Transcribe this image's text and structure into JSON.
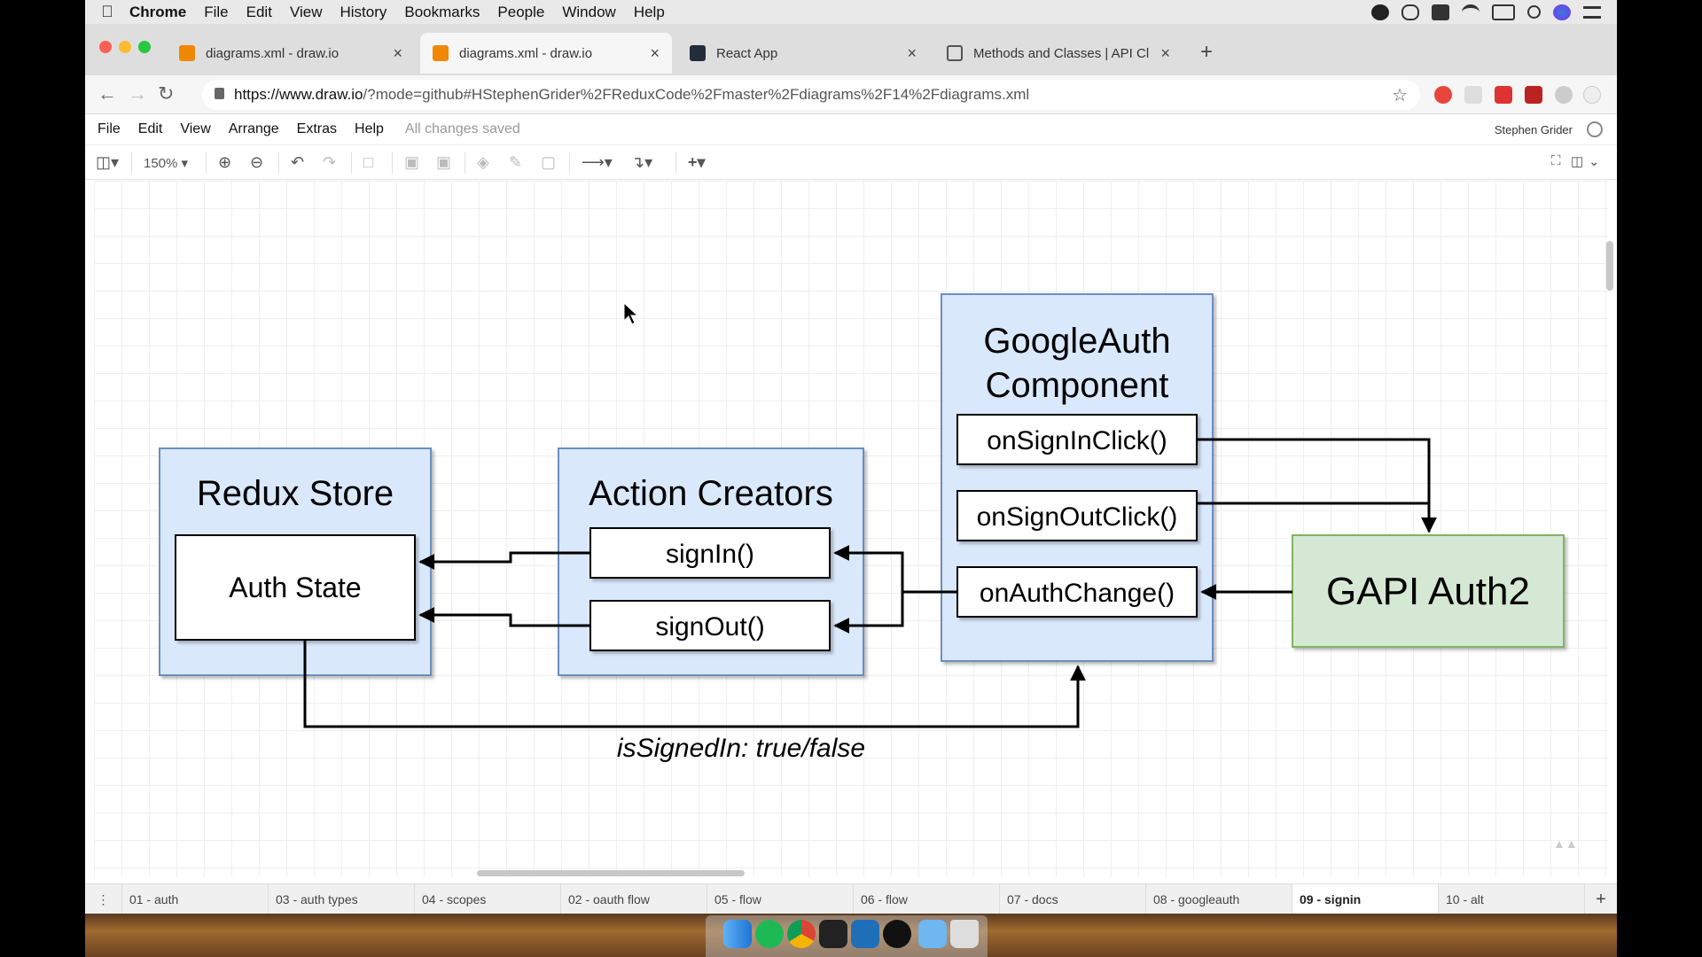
{
  "menubar": {
    "app_name": "Chrome",
    "items": [
      "File",
      "Edit",
      "View",
      "History",
      "Bookmarks",
      "People",
      "Window",
      "Help"
    ]
  },
  "tabs": [
    {
      "title": "diagrams.xml - draw.io",
      "active": false,
      "favicon_color": "#f08705"
    },
    {
      "title": "diagrams.xml - draw.io",
      "active": true,
      "favicon_color": "#f08705"
    },
    {
      "title": "React App",
      "active": false,
      "favicon_color": "#222d3b"
    },
    {
      "title": "Methods and Classes  |  API Cl",
      "active": false,
      "favicon_color": "#ffffff"
    }
  ],
  "address_bar": {
    "url_host": "https://www.draw.io",
    "url_rest": "/?mode=github#HStephenGrider%2FReduxCode%2Fmaster%2Fdiagrams%2F14%2Fdiagrams.xml"
  },
  "app_menu": {
    "items": [
      "File",
      "Edit",
      "View",
      "Arrange",
      "Extras",
      "Help"
    ],
    "status": "All changes saved",
    "user": "Stephen Grider"
  },
  "draw_toolbar": {
    "zoom": "150%"
  },
  "diagram": {
    "redux_store": {
      "title": "Redux Store",
      "child": "Auth State"
    },
    "action_creators": {
      "title": "Action Creators",
      "sign_in": "signIn()",
      "sign_out": "signOut()"
    },
    "google_auth": {
      "title_line1": "GoogleAuth",
      "title_line2": "Component",
      "on_sign_in": "onSignInClick()",
      "on_sign_out": "onSignOutClick()",
      "on_auth_change": "onAuthChange()"
    },
    "gapi": {
      "title": "GAPI Auth2"
    },
    "edge_label": "isSignedIn: true/false",
    "colors": {
      "blue_fill": "#dae8fc",
      "blue_stroke": "#6c8ebf",
      "green_fill": "#d5e8d4",
      "green_stroke": "#82b366"
    }
  },
  "page_tabs": [
    "01 - auth",
    "03 - auth types",
    "04 - scopes",
    "02 - oauth flow",
    "05 - flow",
    "06 - flow",
    "07 - docs",
    "08 - googleauth",
    "09 - signin",
    "10 - alt"
  ],
  "active_page": "09 - signin"
}
